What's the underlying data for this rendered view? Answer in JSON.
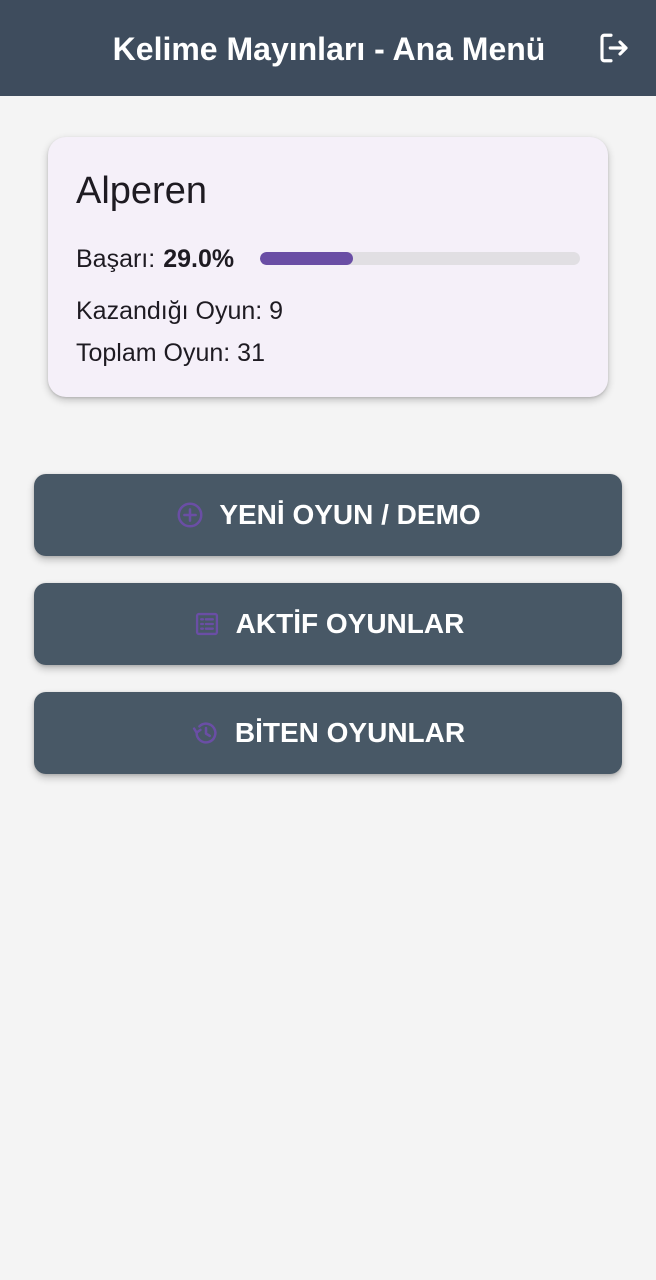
{
  "appbar": {
    "title": "Kelime Mayınları - Ana Menü",
    "logout_icon": "logout-icon"
  },
  "profile": {
    "username": "Alperen",
    "success_label": "Başarı:",
    "success_value": "29.0%",
    "success_fraction": 0.29,
    "won_text": "Kazandığı Oyun: 9",
    "total_text": "Toplam Oyun: 31"
  },
  "menu": {
    "new_game_label": "YENİ OYUN / DEMO",
    "new_game_icon": "add-circle-icon",
    "active_games_label": "AKTİF OYUNLAR",
    "active_games_icon": "list-icon",
    "finished_games_label": "BİTEN OYUNLAR",
    "finished_games_icon": "history-icon"
  },
  "colors": {
    "appbar": "#3e4c5d",
    "button": "#485866",
    "accent": "#6a4ea5",
    "card": "#f5f0f9",
    "background": "#f4f4f4"
  }
}
